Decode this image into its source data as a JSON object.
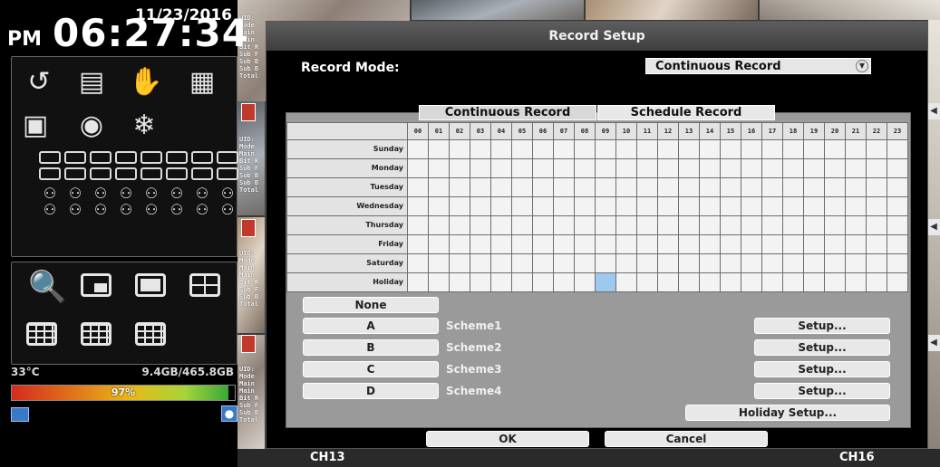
{
  "clock": {
    "date": "11/23/2016",
    "ampm": "PM",
    "time": "06:27:34"
  },
  "status": {
    "temperature": "33°C",
    "disk": "9.4GB/465.8GB",
    "disk_percent": "97%",
    "disk_fill_fraction": 0.97
  },
  "dialog": {
    "title": "Record Setup",
    "record_mode_label": "Record Mode:",
    "record_mode_value": "Continuous Record",
    "tabs": [
      "Continuous Record",
      "Schedule Record"
    ],
    "hours": [
      "00",
      "01",
      "02",
      "03",
      "04",
      "05",
      "06",
      "07",
      "08",
      "09",
      "10",
      "11",
      "12",
      "13",
      "14",
      "15",
      "16",
      "17",
      "18",
      "19",
      "20",
      "21",
      "22",
      "23"
    ],
    "days": [
      "Sunday",
      "Monday",
      "Tuesday",
      "Wednesday",
      "Thursday",
      "Friday",
      "Saturday",
      "Holiday"
    ],
    "selected_cell": {
      "day": "Holiday",
      "hour": "09"
    },
    "options": [
      {
        "label": "None"
      },
      {
        "label": "A",
        "scheme": "Scheme1",
        "setup": "Setup..."
      },
      {
        "label": "B",
        "scheme": "Scheme2",
        "setup": "Setup..."
      },
      {
        "label": "C",
        "scheme": "Scheme3",
        "setup": "Setup..."
      },
      {
        "label": "D",
        "scheme": "Scheme4",
        "setup": "Setup..."
      }
    ],
    "holiday_setup": "Holiday Setup...",
    "ok": "OK",
    "cancel": "Cancel"
  },
  "bottom_bar": {
    "left_channel": "CH13",
    "right_channel": "CH16"
  },
  "colors": {
    "selected_cell": "#9ec9ef",
    "dialog_bg": "#000000",
    "titlebar": "#4a4a4a"
  }
}
